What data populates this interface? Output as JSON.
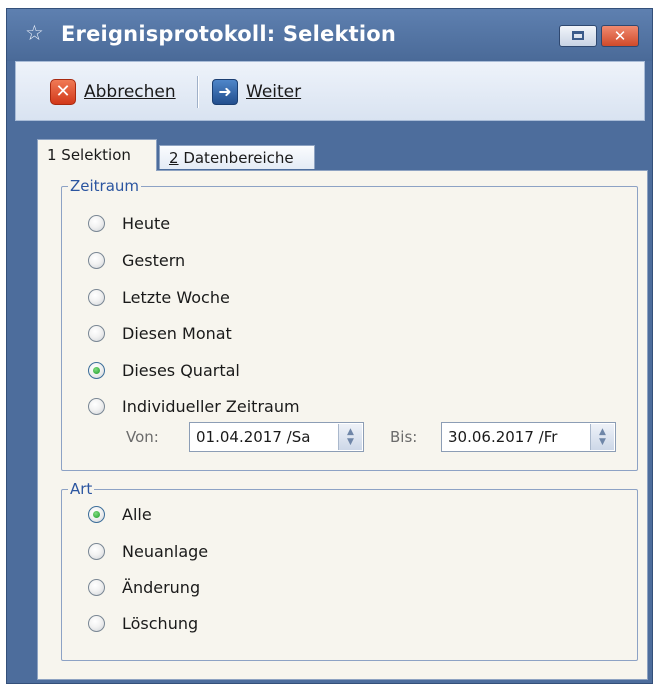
{
  "window": {
    "title": "Ereignisprotokoll: Selektion",
    "close_glyph": "✕"
  },
  "toolbar": {
    "cancel_label": "Abbrechen",
    "next_label": "Weiter"
  },
  "tabs": [
    {
      "label": "1 Selektion",
      "active": true
    },
    {
      "mnemonic": "2",
      "label_rest": " Datenbereiche",
      "active": false
    }
  ],
  "zeitraum": {
    "legend": "Zeitraum",
    "options": [
      {
        "label": "Heute",
        "checked": false
      },
      {
        "label": "Gestern",
        "checked": false
      },
      {
        "label": "Letzte Woche",
        "checked": false
      },
      {
        "label": "Diesen Monat",
        "checked": false
      },
      {
        "label": "Dieses Quartal",
        "checked": true
      },
      {
        "label": "Individueller Zeitraum",
        "checked": false
      }
    ],
    "from_label": "Von:",
    "from_value": "01.04.2017 /Sa",
    "to_label": "Bis:",
    "to_value": "30.06.2017 /Fr"
  },
  "art": {
    "legend": "Art",
    "options": [
      {
        "label": "Alle",
        "checked": true
      },
      {
        "label": "Neuanlage",
        "checked": false
      },
      {
        "label": "Änderung",
        "checked": false
      },
      {
        "label": "Löschung",
        "checked": false
      }
    ]
  },
  "icons": {
    "title": "star-outline-icon",
    "cancel": "cancel-x-icon",
    "next": "arrow-right-icon",
    "spinner": "spinner-arrows-icon"
  },
  "colors": {
    "window_frame": "#4d6d9c",
    "panel_background": "#f7f5ee",
    "legend_text": "#2b55a0",
    "radio_checked": "#1d9b2a",
    "cancel_icon": "#d2381a",
    "next_icon": "#234f8e"
  }
}
